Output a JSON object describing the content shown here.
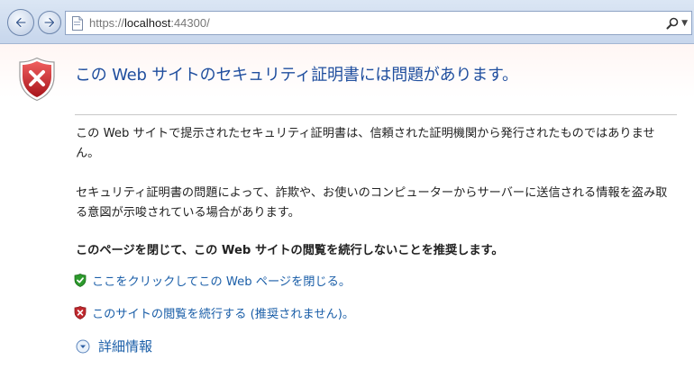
{
  "browser": {
    "url_scheme": "https://",
    "url_host": "localhost",
    "url_port": ":44300/"
  },
  "error_page": {
    "title": "この Web サイトのセキュリティ証明書には問題があります。",
    "paragraph1": "この Web サイトで提示されたセキュリティ証明書は、信頼された証明機関から発行されたものではありません。",
    "paragraph2": "セキュリティ証明書の問題によって、詐欺や、お使いのコンピューターからサーバーに送信される情報を盗み取る意図が示唆されている場合があります。",
    "recommendation": "このページを閉じて、この Web サイトの閲覧を続行しないことを推奨します。",
    "close_link": "ここをクリックしてこの Web ページを閉じる。",
    "continue_link": "このサイトの閲覧を続行する (推奨されません)。",
    "more_info": "詳細情報"
  },
  "icons": {
    "back": "back-arrow-icon",
    "forward": "forward-arrow-icon",
    "page": "page-icon",
    "search": "search-icon",
    "dropdown": "chevron-down-icon",
    "error_shield": "red-shield-x-icon",
    "close_shield": "green-shield-check-icon",
    "continue_shield": "red-shield-x-icon",
    "more_info": "chevron-down-circle-icon"
  },
  "colors": {
    "title": "#1f4e9e",
    "link": "#1a5ea8",
    "error_red": "#c0282d",
    "ok_green": "#2c9a2c"
  }
}
